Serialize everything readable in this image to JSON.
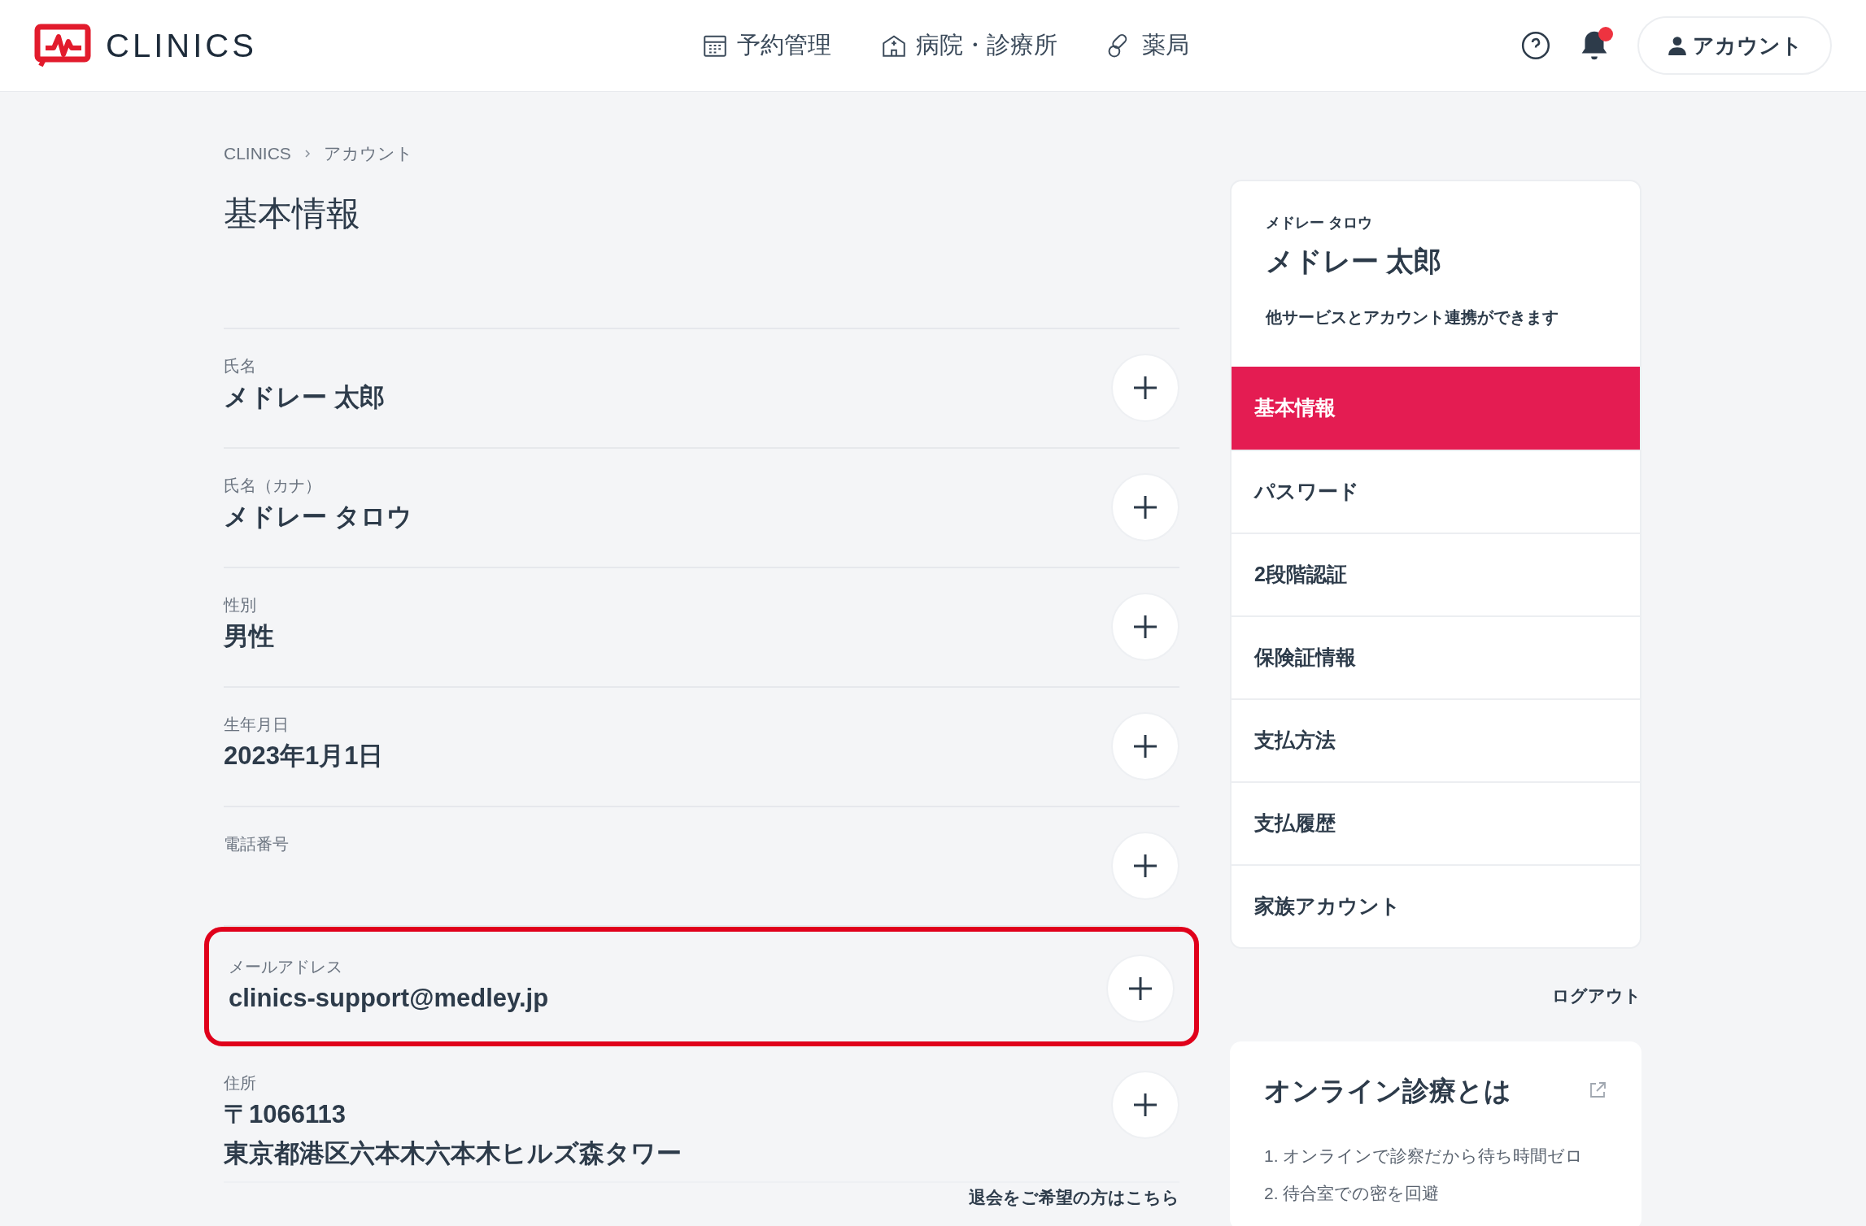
{
  "header": {
    "logo_text": "CLINICS",
    "nav": [
      {
        "kind": "calendar",
        "label": "予約管理"
      },
      {
        "kind": "hospital",
        "label": "病院・診療所"
      },
      {
        "kind": "pills",
        "label": "薬局"
      }
    ],
    "notification_badge": true,
    "account_button": "アカウント"
  },
  "breadcrumb": [
    "CLINICS",
    "アカウント"
  ],
  "page_title": "基本情報",
  "fields": [
    {
      "label": "氏名",
      "values": [
        "メドレー 太郎"
      ],
      "highlighted": false
    },
    {
      "label": "氏名（カナ）",
      "values": [
        "メドレー タロウ"
      ],
      "highlighted": false
    },
    {
      "label": "性別",
      "values": [
        "男性"
      ],
      "highlighted": false
    },
    {
      "label": "生年月日",
      "values": [
        "2023年1月1日"
      ],
      "highlighted": false
    },
    {
      "label": "電話番号",
      "highlighted": false
    },
    {
      "label": "メールアドレス",
      "values": [
        "clinics-support@medley.jp"
      ],
      "highlighted": true
    },
    {
      "label": "住所",
      "values": [
        "〒1066113",
        "東京都港区六本木六本木ヒルズ森タワー"
      ],
      "highlighted": false
    }
  ],
  "withdraw_link": "退会をご希望の方はこちら",
  "profile_card": {
    "kana": "メドレー タロウ",
    "name": "メドレー 太郎",
    "note": "他サービスとアカウント連携ができます"
  },
  "side_menu": [
    {
      "label": "基本情報",
      "selected": true
    },
    {
      "label": "パスワード",
      "selected": false
    },
    {
      "label": "2段階認証",
      "selected": false
    },
    {
      "label": "保険証情報",
      "selected": false
    },
    {
      "label": "支払方法",
      "selected": false
    },
    {
      "label": "支払履歴",
      "selected": false
    },
    {
      "label": "家族アカウント",
      "selected": false
    }
  ],
  "logout": "ログアウト",
  "info_card": {
    "title": "オンライン診療とは",
    "items": [
      "1. オンラインで診察だから待ち時間ゼロ",
      "2. 待合室での密を回避"
    ]
  }
}
